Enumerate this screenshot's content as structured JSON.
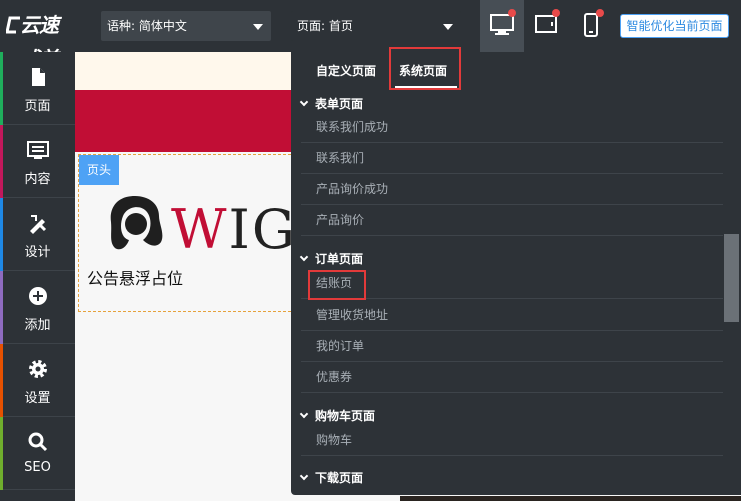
{
  "logo": {
    "text": "云速成美站"
  },
  "toolbar": {
    "language_prefix": "语种:",
    "language_value": "简体中文",
    "page_prefix": "页面:",
    "page_value": "首页",
    "optimize_label": "智能优化当前页面",
    "devices": [
      "desktop-icon",
      "tablet-icon",
      "mobile-icon"
    ]
  },
  "sidebar": {
    "items": [
      {
        "label": "页面",
        "icon": "file-icon",
        "color": "#1fae5c"
      },
      {
        "label": "内容",
        "icon": "content-icon",
        "color": "#c2185b"
      },
      {
        "label": "设计",
        "icon": "design-icon",
        "color": "#1e88e5"
      },
      {
        "label": "添加",
        "icon": "add-icon",
        "color": "#8e6bbf"
      },
      {
        "label": "设置",
        "icon": "gear-icon",
        "color": "#e65100"
      },
      {
        "label": "SEO",
        "icon": "search-icon",
        "color": "#6fae2d"
      }
    ]
  },
  "canvas": {
    "header_tag": "页头",
    "brand_text": "WIG",
    "notice": "公告悬浮占位"
  },
  "dropdown": {
    "tabs": [
      {
        "label": "自定义页面",
        "active": false
      },
      {
        "label": "系统页面",
        "active": true
      }
    ],
    "groups": [
      {
        "title": "表单页面",
        "items": [
          "联系我们成功",
          "联系我们",
          "产品询价成功",
          "产品询价"
        ]
      },
      {
        "title": "订单页面",
        "items": [
          "结账页",
          "管理收货地址",
          "我的订单",
          "优惠券"
        ]
      },
      {
        "title": "购物车页面",
        "items": [
          "购物车"
        ]
      },
      {
        "title": "下载页面",
        "items": []
      }
    ]
  },
  "colors": {
    "dark": "#2d3237",
    "accent": "#4ea2f5",
    "highlight": "#e23a3a",
    "brand_red": "#c10e35"
  }
}
